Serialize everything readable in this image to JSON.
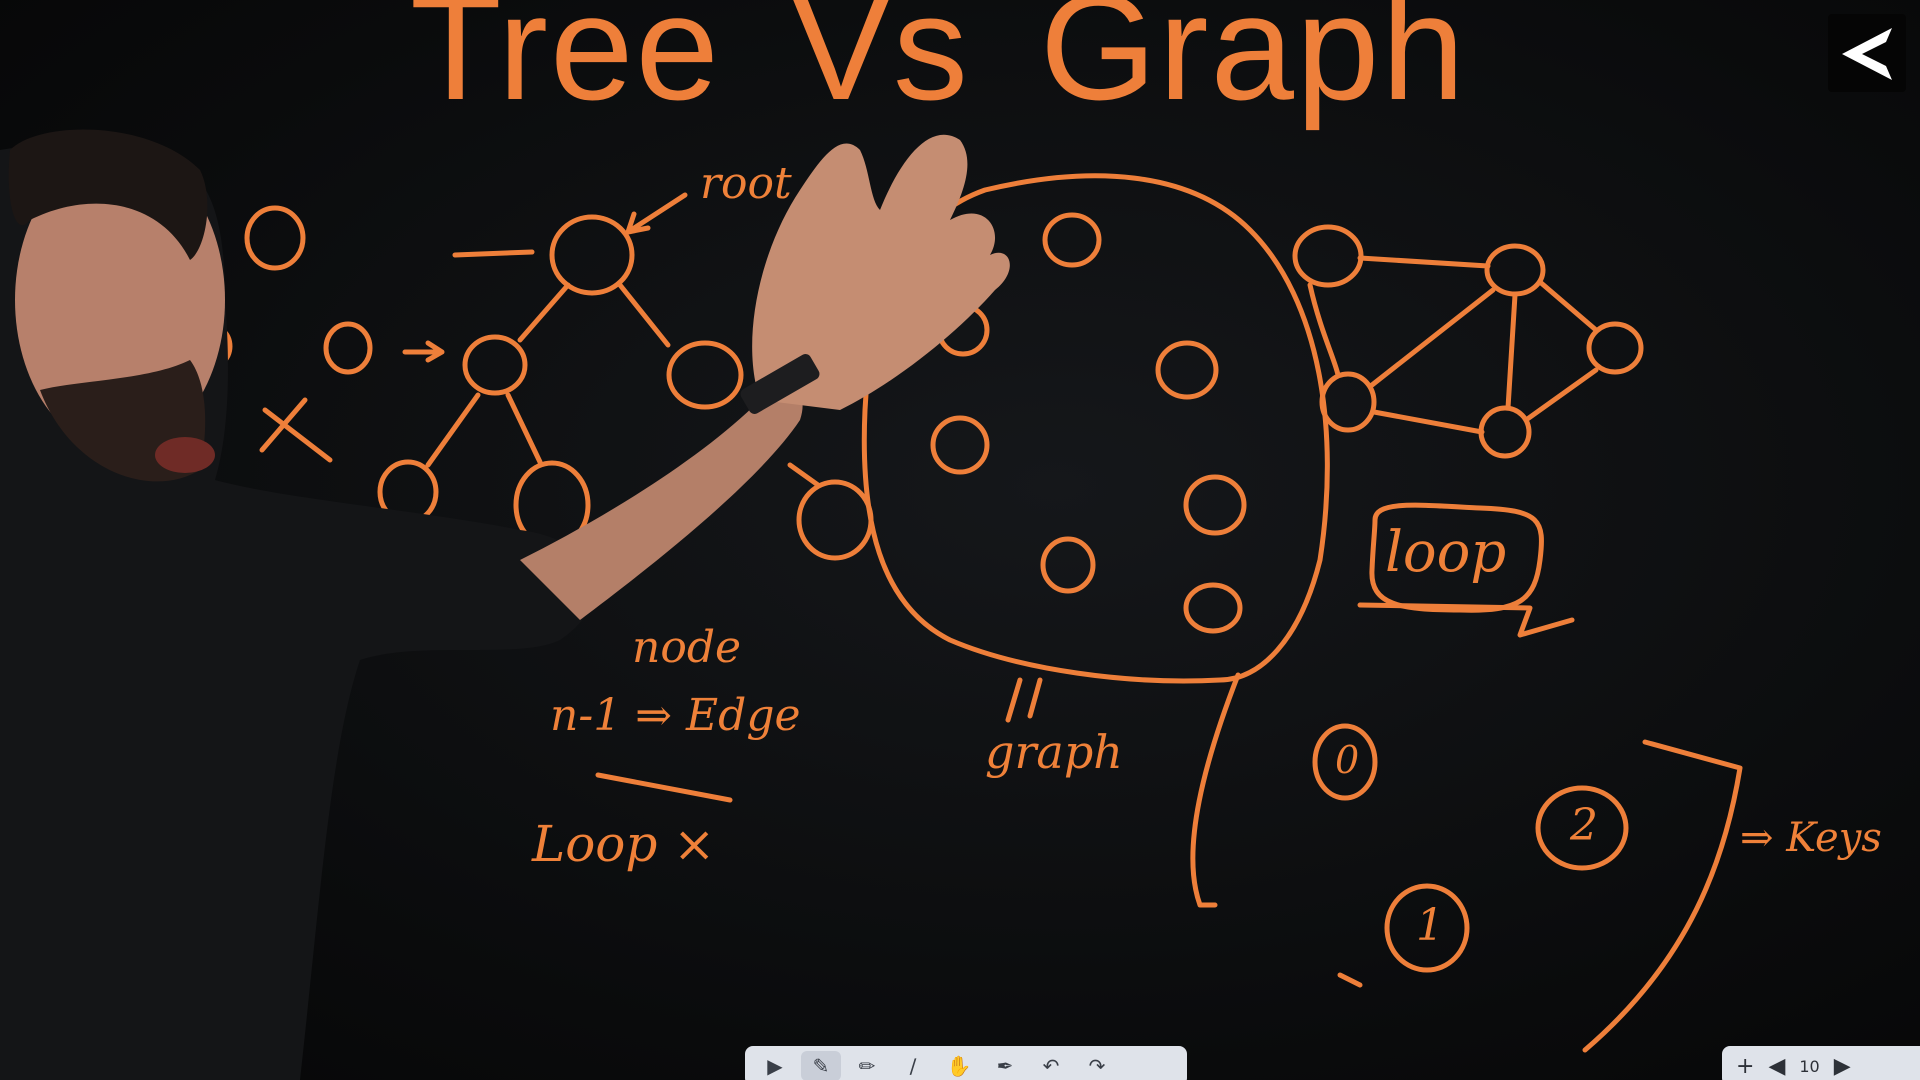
{
  "title": {
    "word_1": "Tree",
    "word_2": "Vs",
    "word_3": "Graph"
  },
  "annotations": {
    "root": "root",
    "node": "node",
    "edge": "n-1 ⇒ Edge",
    "loop_no": "Loop ×",
    "graph": "graph",
    "loop": "loop",
    "keys": "⇒ Keys",
    "node_0": "0",
    "node_1": "1",
    "node_2": "2"
  },
  "toolbar": {
    "tools": [
      "pointer-icon",
      "pen-icon",
      "highlighter-icon",
      "line-icon",
      "hand-icon",
      "marker-icon",
      "undo-icon",
      "redo-icon"
    ]
  },
  "toolbar_right": {
    "page_number": "10"
  },
  "colors": {
    "chalk": "#ee7f3a",
    "board": "#0c0d0f",
    "toolbar": "#dfe3ea"
  }
}
